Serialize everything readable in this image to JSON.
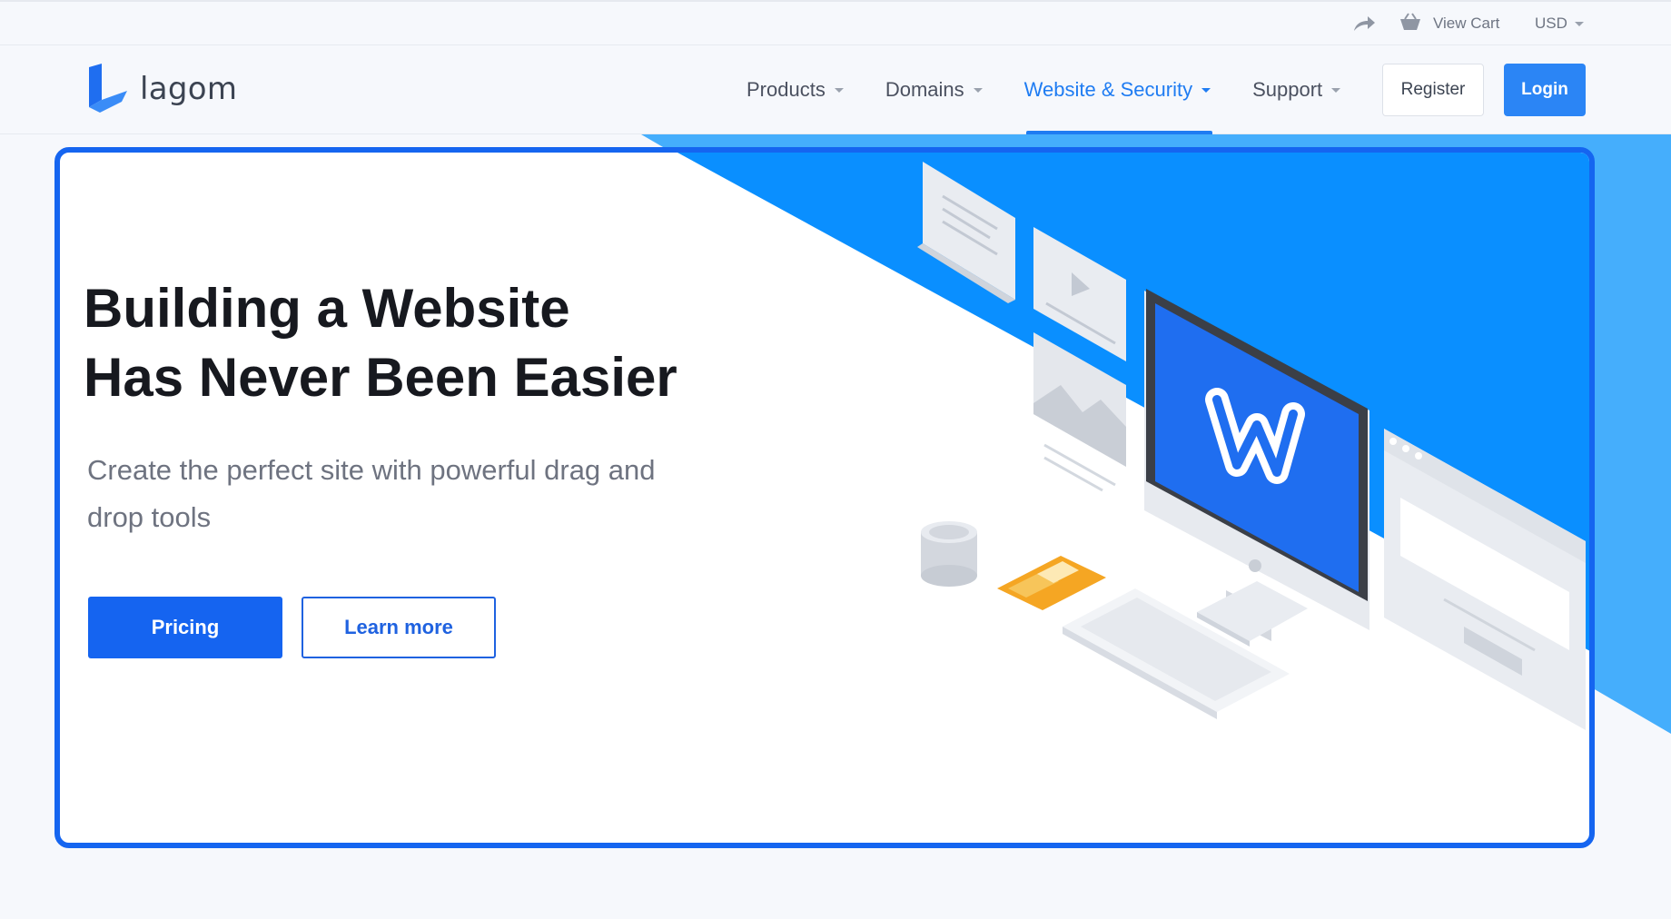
{
  "topbar": {
    "share_icon": "share-arrow-icon",
    "cart_icon": "basket-icon",
    "cart_label": "View Cart",
    "currency": "USD"
  },
  "header": {
    "logo_text": "lagom",
    "nav": [
      {
        "label": "Products",
        "active": false
      },
      {
        "label": "Domains",
        "active": false
      },
      {
        "label": "Website & Security",
        "active": true
      },
      {
        "label": "Support",
        "active": false
      }
    ],
    "register_label": "Register",
    "login_label": "Login"
  },
  "hero": {
    "title_line1": "Building a Website",
    "title_line2": "Has Never Been Easier",
    "subtitle": "Create the perfect site with powerful drag and drop tools",
    "pricing_label": "Pricing",
    "learn_more_label": "Learn more"
  },
  "colors": {
    "accent": "#1f7cf2",
    "primary_button": "#1564f0",
    "hero_blue": "#0a8fff",
    "card_border": "#1565f0"
  }
}
